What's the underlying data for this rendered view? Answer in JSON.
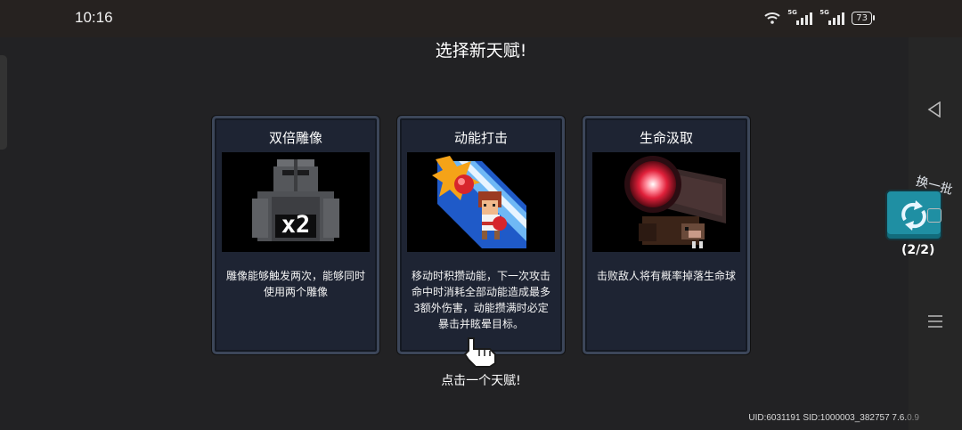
{
  "status_bar": {
    "time": "10:16",
    "signal_tags": [
      "5G",
      "5G"
    ],
    "battery": "73"
  },
  "title": "选择新天赋!",
  "cards": [
    {
      "name": "双倍雕像",
      "badge": "x2",
      "description": "雕像能够触发两次，能够同时使用两个雕像"
    },
    {
      "name": "动能打击",
      "description": "移动时积攒动能，下一次攻击命中时消耗全部动能造成最多3额外伤害，动能攒满时必定暴击并眩晕目标。"
    },
    {
      "name": "生命汲取",
      "description": "击败敌人将有概率掉落生命球"
    }
  ],
  "hint": "点击一个天赋!",
  "refresh": {
    "label": "换一批",
    "count": "(2/2)"
  },
  "footer": {
    "uid": "UID:6031191 SID:1000003_382757 7.6.",
    "version_suffix": "0.9"
  },
  "colors": {
    "card_bg": "#1e2433",
    "card_border": "#3c4659",
    "refresh_button": "#1f8fa3"
  }
}
